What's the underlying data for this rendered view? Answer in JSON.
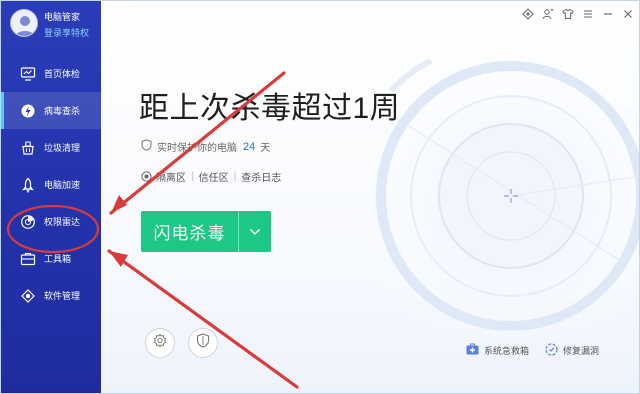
{
  "profile": {
    "name": "电脑管家",
    "vip_link": "登录享特权"
  },
  "sidebar": {
    "items": [
      {
        "label": "首页体检",
        "icon": "monitor-icon"
      },
      {
        "label": "病毒查杀",
        "icon": "virus-scan-icon",
        "active": true
      },
      {
        "label": "垃圾清理",
        "icon": "cleanup-icon"
      },
      {
        "label": "电脑加速",
        "icon": "rocket-icon"
      },
      {
        "label": "权限雷达",
        "icon": "radar-icon"
      },
      {
        "label": "工具箱",
        "icon": "toolbox-icon"
      },
      {
        "label": "软件管理",
        "icon": "app-manager-icon"
      }
    ]
  },
  "window_controls": [
    "skin-icon",
    "user-switch-icon",
    "shirt-icon",
    "menu-icon",
    "minimize-icon",
    "close-icon"
  ],
  "main": {
    "headline": "距上次杀毒超过1周",
    "protect_prefix": "实时保护你的电脑",
    "protect_days": "24",
    "protect_unit": "天",
    "links": [
      "隔离区",
      "信任区",
      "查杀日志"
    ],
    "scan_button": "闪电杀毒",
    "bottom_links": [
      {
        "label": "系统急救箱",
        "icon": "first-aid-icon"
      },
      {
        "label": "修复漏洞",
        "icon": "repair-icon"
      }
    ]
  },
  "colors": {
    "sidebar": "#2434ad",
    "accent_green": "#1dc884",
    "link_blue": "#2e66d6",
    "annotation_red": "#d93a3a"
  }
}
